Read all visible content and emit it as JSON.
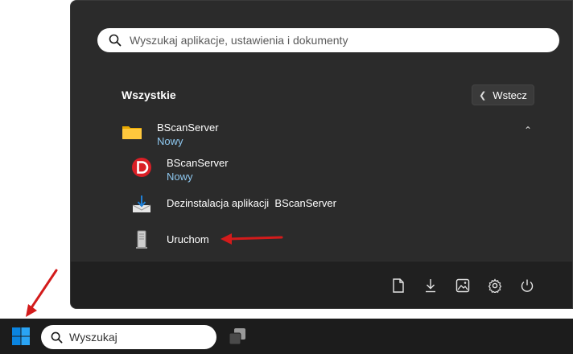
{
  "start_menu": {
    "search": {
      "placeholder": "Wyszukaj aplikacje, ustawienia i dokumenty",
      "value": ""
    },
    "section_title": "Wszystkie",
    "back_label": "Wstecz",
    "folder": {
      "name": "BScanServer",
      "badge": "Nowy"
    },
    "items": [
      {
        "name": "BScanServer",
        "badge": "Nowy",
        "icon": "bscan-d-icon"
      },
      {
        "name": "Dezinstalacja aplikacji  BScanServer",
        "icon": "uninstall-download-icon"
      },
      {
        "name": "Uruchom",
        "icon": "server-tower-icon"
      }
    ],
    "footer_icons": [
      "document-icon",
      "download-icon",
      "pictures-icon",
      "settings-gear-icon",
      "power-icon"
    ]
  },
  "taskbar": {
    "search": {
      "placeholder": "Wyszukaj",
      "value": ""
    }
  },
  "colors": {
    "menu_bg": "#2b2b2b",
    "footer_bg": "#202020",
    "taskbar_bg": "#1c1c1c",
    "badge_blue": "#8ec8f0",
    "annotation_red": "#d31b1b",
    "windows_blue": "#0a84e0"
  }
}
